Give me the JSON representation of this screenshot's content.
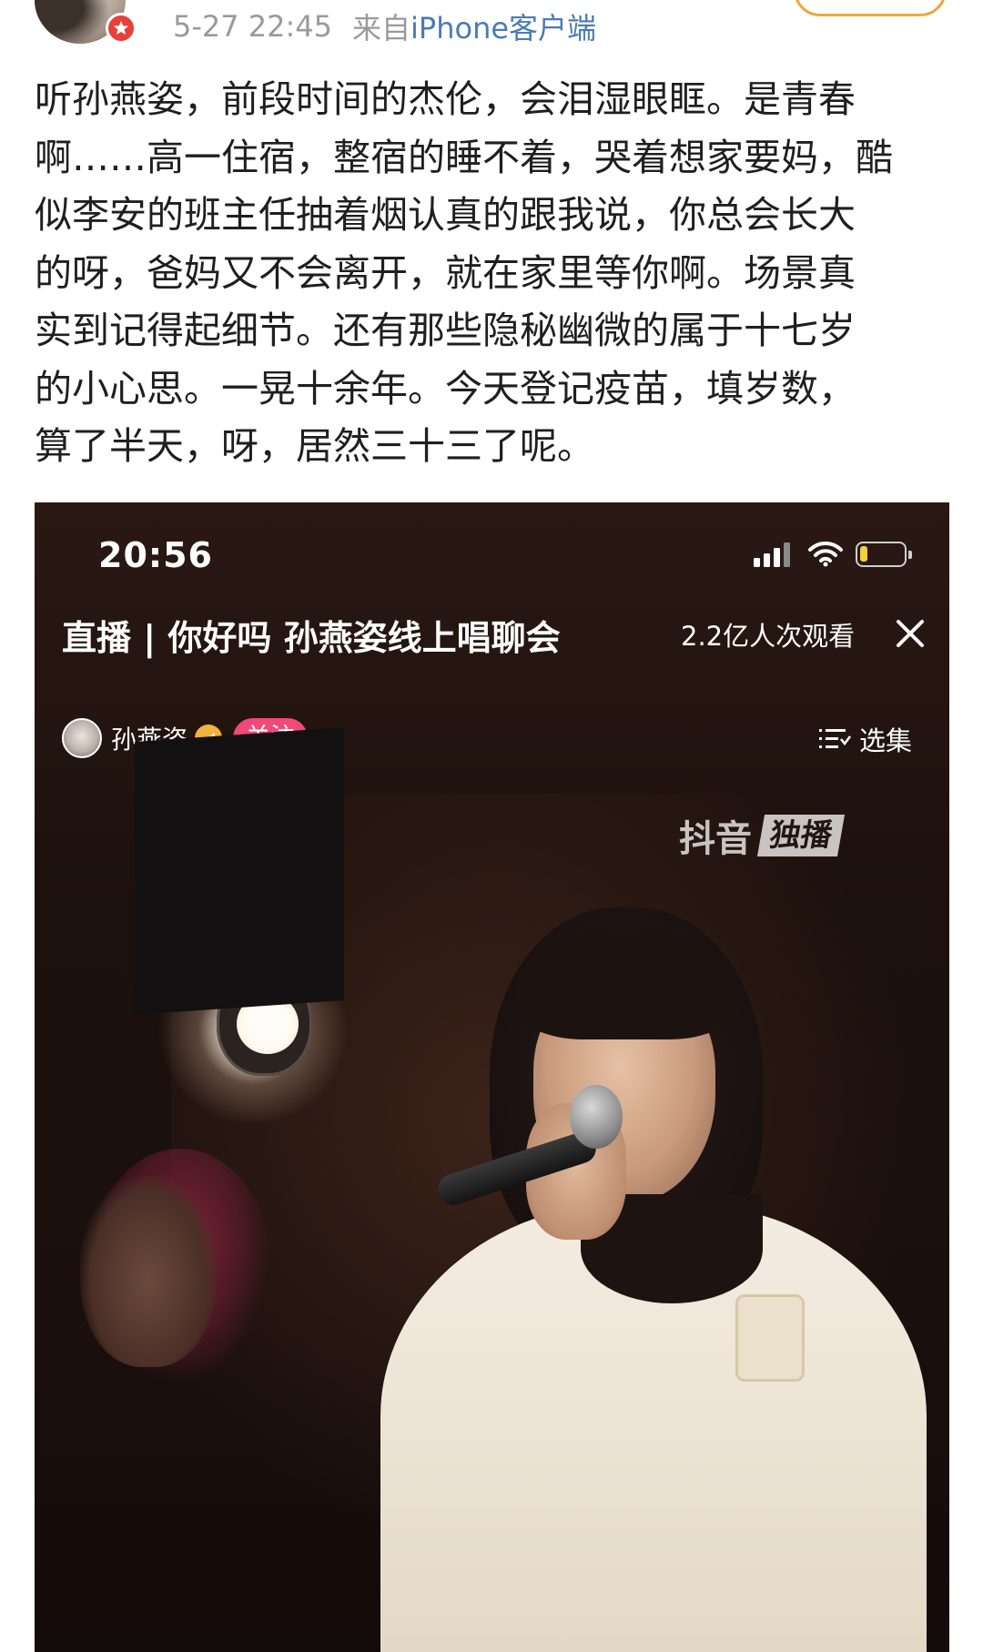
{
  "post": {
    "time": "5-27 22:45",
    "source_prefix": "来自",
    "source_link": "iPhone客户端",
    "text_lines": [
      "听孙燕姿，前段时间的杰伦，会泪湿眼眶。是青春",
      "啊……高一住宿，整宿的睡不着，哭着想家要妈，酷",
      "似李安的班主任抽着烟认真的跟我说，你总会长大",
      "的呀，爸妈又不会离开，就在家里等你啊。场景真",
      "实到记得起细节。还有那些隐秘幽微的属于十七岁",
      "的小心思。一晃十余年。今天登记疫苗，填岁数，",
      "算了半天，呀，居然三十三了呢。"
    ]
  },
  "embedded_screenshot": {
    "status_time": "20:56",
    "battery_level": 0.18,
    "live_title": "直播 | 你好吗 孙燕姿线上唱聊会",
    "view_count": "2.2亿人次观看",
    "host_name": "孙燕姿",
    "follow_label": "关注",
    "episodes_label": "选集",
    "watermark_brand": "抖音",
    "watermark_tag": "独播"
  },
  "colors": {
    "link": "#4a7bb5",
    "meta_gray": "#9a9a9a",
    "follow_pink": "#f0497a",
    "badge_red": "#e8403a",
    "verified_gold": "#f1b43a"
  }
}
